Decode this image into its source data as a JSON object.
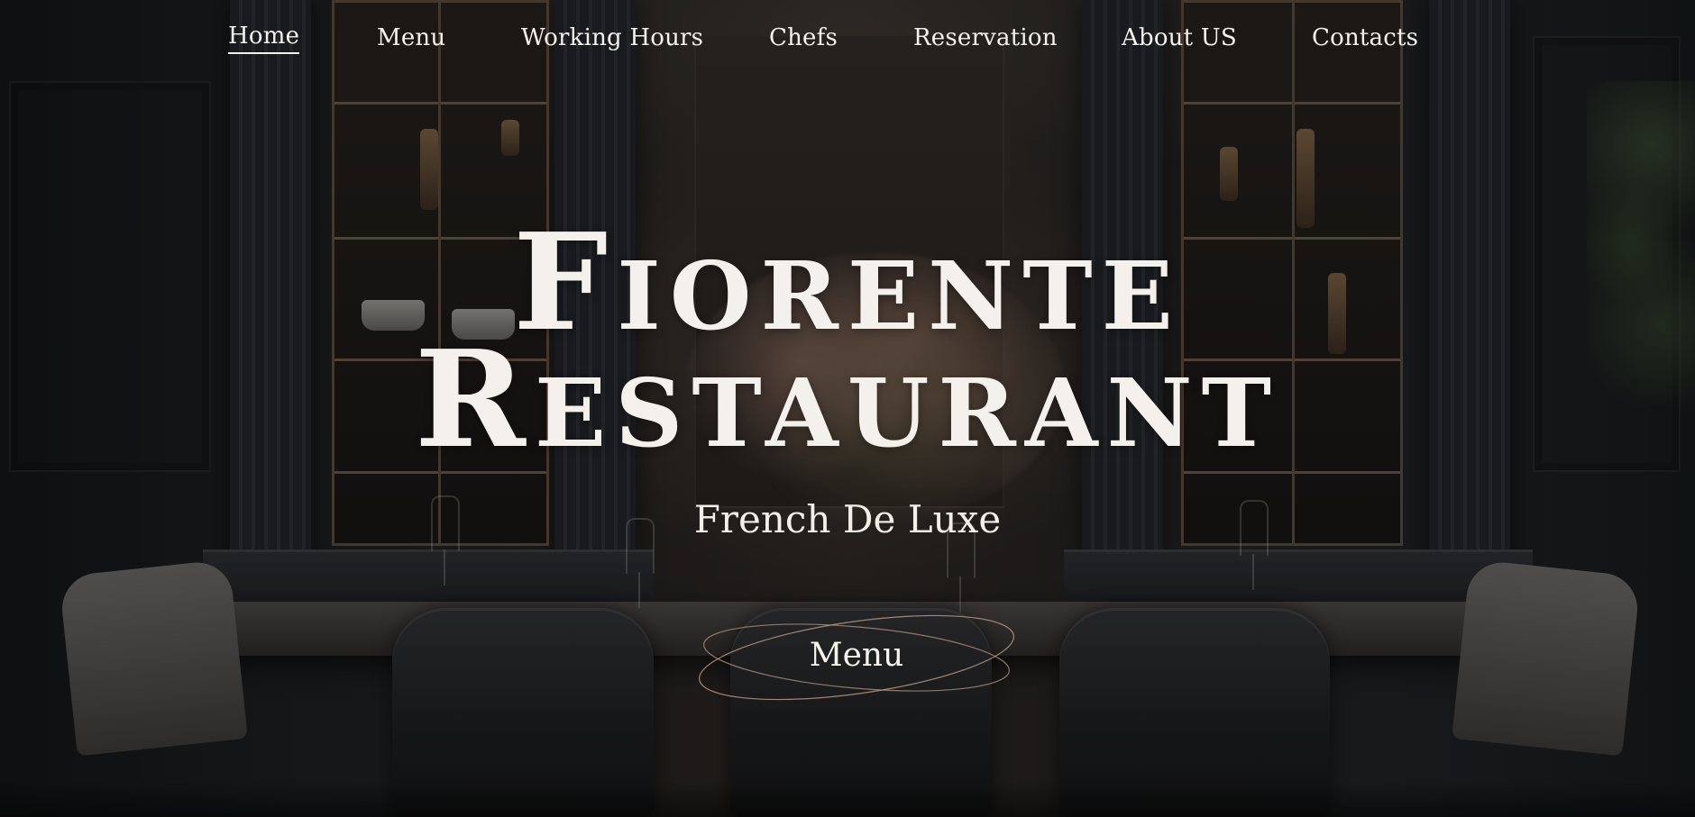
{
  "nav": {
    "items": [
      {
        "label": "Home",
        "active": true
      },
      {
        "label": "Menu",
        "active": false
      },
      {
        "label": "Working Hours",
        "active": false
      },
      {
        "label": "Chefs",
        "active": false
      },
      {
        "label": "Reservation",
        "active": false
      },
      {
        "label": "About US",
        "active": false
      },
      {
        "label": "Contacts",
        "active": false
      }
    ]
  },
  "hero": {
    "title_line_1": "Fiorente",
    "title_line_2": "Restaurant",
    "subtitle": "French De Luxe",
    "cta_label": "Menu"
  },
  "colors": {
    "text": "#f4f1ec",
    "ring": "#b89a86",
    "background": "#121212"
  }
}
